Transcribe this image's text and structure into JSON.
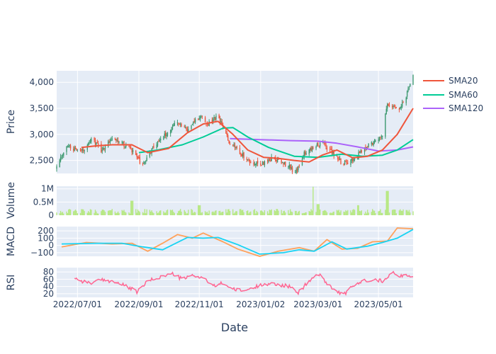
{
  "chart_data": {
    "type": "candlestick",
    "xlabel": "Date",
    "x_range": [
      "2022-06-10",
      "2023-06-05"
    ],
    "x_ticks": [
      "2022/07/01",
      "2022/09/01",
      "2022/11/01",
      "2023/01/02",
      "2023/03/01",
      "2023/05/01"
    ],
    "legend": {
      "placement": "top-right",
      "entries": [
        "SMA20",
        "SMA60",
        "SMA120"
      ]
    },
    "colors": {
      "increasing": "#3D9970",
      "decreasing": "#EF553B",
      "sma20": "#EF553B",
      "sma60": "#00CC96",
      "sma120": "#AB63FA",
      "volume": "#b6e880",
      "macd": "#FFA15A",
      "signal": "#19D3F3",
      "rsi": "#FF6692",
      "plot_bg": "#E5ECF6",
      "grid": "#ffffff"
    },
    "panels": [
      {
        "ylabel": "Price",
        "yrange": [
          2250,
          4220
        ],
        "yticks": [
          2500,
          3000,
          3500,
          4000
        ],
        "ytick_labels": [
          "2,500",
          "3,000",
          "3,500",
          "4,000"
        ],
        "price_path": [
          [
            "2022-06-10",
            2350
          ],
          [
            "2022-06-20",
            2780
          ],
          [
            "2022-07-05",
            2650
          ],
          [
            "2022-07-15",
            2930
          ],
          [
            "2022-07-25",
            2700
          ],
          [
            "2022-08-05",
            2950
          ],
          [
            "2022-08-15",
            2820
          ],
          [
            "2022-08-25",
            2700
          ],
          [
            "2022-09-05",
            2400
          ],
          [
            "2022-09-15",
            2750
          ],
          [
            "2022-09-22",
            2900
          ],
          [
            "2022-10-01",
            3050
          ],
          [
            "2022-10-10",
            3250
          ],
          [
            "2022-10-20",
            3050
          ],
          [
            "2022-10-28",
            3300
          ],
          [
            "2022-11-03",
            3350
          ],
          [
            "2022-11-10",
            3200
          ],
          [
            "2022-11-20",
            3350
          ],
          [
            "2022-12-01",
            2850
          ],
          [
            "2022-12-10",
            2700
          ],
          [
            "2022-12-20",
            2500
          ],
          [
            "2023-01-02",
            2420
          ],
          [
            "2023-01-15",
            2550
          ],
          [
            "2023-01-25",
            2450
          ],
          [
            "2023-02-02",
            2350
          ],
          [
            "2023-02-05",
            2200
          ],
          [
            "2023-02-15",
            2650
          ],
          [
            "2023-02-25",
            2750
          ],
          [
            "2023-03-05",
            2850
          ],
          [
            "2023-03-15",
            2650
          ],
          [
            "2023-03-25",
            2450
          ],
          [
            "2023-04-05",
            2500
          ],
          [
            "2023-04-15",
            2700
          ],
          [
            "2023-04-25",
            2850
          ],
          [
            "2023-05-05",
            3000
          ],
          [
            "2023-05-10",
            3600
          ],
          [
            "2023-05-20",
            3450
          ],
          [
            "2023-05-28",
            3700
          ],
          [
            "2023-06-05",
            4100
          ]
        ],
        "sma20": [
          [
            "2022-07-05",
            2750
          ],
          [
            "2022-07-20",
            2780
          ],
          [
            "2022-08-05",
            2800
          ],
          [
            "2022-08-25",
            2800
          ],
          [
            "2022-09-10",
            2650
          ],
          [
            "2022-10-01",
            2730
          ],
          [
            "2022-10-20",
            3030
          ],
          [
            "2022-11-05",
            3200
          ],
          [
            "2022-11-20",
            3250
          ],
          [
            "2022-12-05",
            3000
          ],
          [
            "2022-12-20",
            2700
          ],
          [
            "2023-01-05",
            2560
          ],
          [
            "2023-01-20",
            2540
          ],
          [
            "2023-02-05",
            2500
          ],
          [
            "2023-02-20",
            2470
          ],
          [
            "2023-03-05",
            2600
          ],
          [
            "2023-03-20",
            2700
          ],
          [
            "2023-04-05",
            2550
          ],
          [
            "2023-04-20",
            2580
          ],
          [
            "2023-05-05",
            2700
          ],
          [
            "2023-05-20",
            3000
          ],
          [
            "2023-06-05",
            3500
          ]
        ],
        "sma60": [
          [
            "2022-09-01",
            2650
          ],
          [
            "2022-09-20",
            2700
          ],
          [
            "2022-10-15",
            2800
          ],
          [
            "2022-11-05",
            2950
          ],
          [
            "2022-11-25",
            3120
          ],
          [
            "2022-12-05",
            3130
          ],
          [
            "2022-12-20",
            2950
          ],
          [
            "2023-01-10",
            2750
          ],
          [
            "2023-02-05",
            2580
          ],
          [
            "2023-03-01",
            2560
          ],
          [
            "2023-03-25",
            2620
          ],
          [
            "2023-04-15",
            2580
          ],
          [
            "2023-05-05",
            2600
          ],
          [
            "2023-05-20",
            2700
          ],
          [
            "2023-06-05",
            2900
          ]
        ],
        "sma120": [
          [
            "2022-12-02",
            2920
          ],
          [
            "2023-01-01",
            2900
          ],
          [
            "2023-02-01",
            2880
          ],
          [
            "2023-03-01",
            2870
          ],
          [
            "2023-03-20",
            2830
          ],
          [
            "2023-04-10",
            2760
          ],
          [
            "2023-05-01",
            2680
          ],
          [
            "2023-05-20",
            2700
          ],
          [
            "2023-06-05",
            2760
          ]
        ]
      },
      {
        "ylabel": "Volume",
        "yrange": [
          0,
          1100000
        ],
        "yticks": [
          0,
          500000,
          1000000
        ],
        "ytick_labels": [
          "0",
          "0.5M",
          "1M"
        ],
        "spikes": [
          [
            "2022-08-25",
            550000
          ],
          [
            "2022-11-01",
            380000
          ],
          [
            "2023-02-25",
            1080000
          ],
          [
            "2023-03-01",
            420000
          ],
          [
            "2023-04-10",
            380000
          ],
          [
            "2023-05-10",
            920000
          ]
        ]
      },
      {
        "ylabel": "MACD",
        "yrange": [
          -150,
          260
        ],
        "yticks": [
          -100,
          0,
          100,
          200
        ],
        "ytick_labels": [
          "−100",
          "0",
          "100",
          "200"
        ],
        "macd": [
          [
            "2022-06-15",
            -20
          ],
          [
            "2022-07-10",
            40
          ],
          [
            "2022-08-05",
            20
          ],
          [
            "2022-08-25",
            30
          ],
          [
            "2022-09-10",
            -80
          ],
          [
            "2022-09-25",
            30
          ],
          [
            "2022-10-10",
            150
          ],
          [
            "2022-10-25",
            100
          ],
          [
            "2022-11-05",
            170
          ],
          [
            "2022-11-25",
            50
          ],
          [
            "2022-12-10",
            -50
          ],
          [
            "2023-01-01",
            -150
          ],
          [
            "2023-01-20",
            -80
          ],
          [
            "2023-02-10",
            -30
          ],
          [
            "2023-02-25",
            -80
          ],
          [
            "2023-03-10",
            80
          ],
          [
            "2023-03-25",
            -50
          ],
          [
            "2023-04-10",
            -40
          ],
          [
            "2023-04-25",
            50
          ],
          [
            "2023-05-10",
            60
          ],
          [
            "2023-05-20",
            240
          ],
          [
            "2023-06-05",
            230
          ]
        ],
        "signal": [
          [
            "2022-06-15",
            20
          ],
          [
            "2022-07-20",
            30
          ],
          [
            "2022-08-15",
            30
          ],
          [
            "2022-09-05",
            -20
          ],
          [
            "2022-09-25",
            -60
          ],
          [
            "2022-10-20",
            110
          ],
          [
            "2022-11-05",
            100
          ],
          [
            "2022-11-20",
            110
          ],
          [
            "2022-12-10",
            10
          ],
          [
            "2023-01-01",
            -120
          ],
          [
            "2023-01-25",
            -100
          ],
          [
            "2023-02-10",
            -60
          ],
          [
            "2023-02-25",
            -80
          ],
          [
            "2023-03-15",
            50
          ],
          [
            "2023-03-30",
            -50
          ],
          [
            "2023-04-20",
            -10
          ],
          [
            "2023-05-05",
            40
          ],
          [
            "2023-05-20",
            100
          ],
          [
            "2023-06-05",
            220
          ]
        ]
      },
      {
        "ylabel": "RSI",
        "yrange": [
          10,
          92
        ],
        "yticks": [
          20,
          40,
          60,
          80
        ],
        "ytick_labels": [
          "20",
          "40",
          "60",
          "80"
        ],
        "rsi": [
          [
            "2022-06-28",
            65
          ],
          [
            "2022-07-05",
            55
          ],
          [
            "2022-07-15",
            50
          ],
          [
            "2022-07-25",
            58
          ],
          [
            "2022-08-05",
            55
          ],
          [
            "2022-08-20",
            40
          ],
          [
            "2022-08-30",
            25
          ],
          [
            "2022-09-10",
            55
          ],
          [
            "2022-09-25",
            68
          ],
          [
            "2022-10-05",
            75
          ],
          [
            "2022-10-15",
            60
          ],
          [
            "2022-10-25",
            70
          ],
          [
            "2022-11-05",
            65
          ],
          [
            "2022-11-15",
            40
          ],
          [
            "2022-11-25",
            50
          ],
          [
            "2022-12-05",
            32
          ],
          [
            "2022-12-15",
            28
          ],
          [
            "2022-12-25",
            35
          ],
          [
            "2023-01-05",
            48
          ],
          [
            "2023-01-20",
            45
          ],
          [
            "2023-02-01",
            40
          ],
          [
            "2023-02-08",
            20
          ],
          [
            "2023-02-20",
            55
          ],
          [
            "2023-03-01",
            75
          ],
          [
            "2023-03-10",
            50
          ],
          [
            "2023-03-20",
            25
          ],
          [
            "2023-03-28",
            20
          ],
          [
            "2023-04-05",
            40
          ],
          [
            "2023-04-15",
            55
          ],
          [
            "2023-04-25",
            60
          ],
          [
            "2023-05-05",
            55
          ],
          [
            "2023-05-15",
            80
          ],
          [
            "2023-05-22",
            65
          ],
          [
            "2023-05-28",
            75
          ],
          [
            "2023-06-05",
            65
          ]
        ]
      }
    ]
  }
}
